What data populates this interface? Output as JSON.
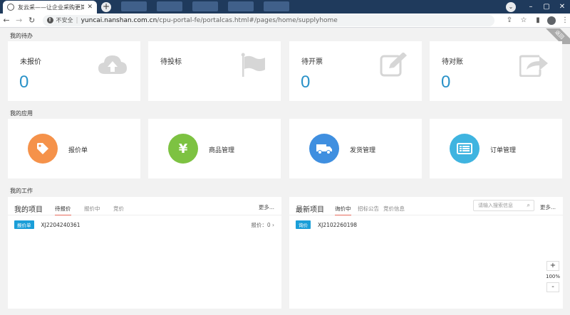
{
  "browser": {
    "tab_title": "友云采——让企业采购更简单",
    "tab_close": "✕",
    "new_tab": "+",
    "insecure_label": "不安全",
    "url_host": "yuncai.nanshan.com.cn",
    "url_path": "/cpu-portal-fe/portalcas.html#/pages/home/supplyhome"
  },
  "corner_flag": "返回",
  "todo": {
    "title": "我的待办",
    "items": [
      {
        "label": "未报价",
        "value": "0",
        "icon": "cloud-upload-icon"
      },
      {
        "label": "待投标",
        "value": "",
        "icon": "flag-icon"
      },
      {
        "label": "待开票",
        "value": "0",
        "icon": "edit-icon"
      },
      {
        "label": "待对账",
        "value": "0",
        "icon": "share-icon"
      }
    ]
  },
  "apps": {
    "title": "我的应用",
    "items": [
      {
        "label": "报价单",
        "color": "#f5924a",
        "icon": "tag-icon"
      },
      {
        "label": "商品管理",
        "color": "#7dc242",
        "icon": "yen-icon"
      },
      {
        "label": "发货管理",
        "color": "#3f8fe0",
        "icon": "truck-icon"
      },
      {
        "label": "订单管理",
        "color": "#3fb4e0",
        "icon": "order-list-icon"
      }
    ]
  },
  "work": {
    "title": "我的工作",
    "my_projects": {
      "title": "我的项目",
      "tabs": [
        "待报价",
        "报价中",
        "竞价"
      ],
      "more": "更多...",
      "rows": [
        {
          "badge": "报价单",
          "code": "XJ2204240361",
          "right": "报价：0 ›"
        }
      ]
    },
    "latest_projects": {
      "title": "最新项目",
      "tabs": [
        "询价中",
        "招标公告",
        "竞价信息"
      ],
      "search_placeholder": "请输入搜索信息",
      "more": "更多...",
      "rows": [
        {
          "badge": "询价",
          "code": "XJ2102260198"
        }
      ]
    }
  },
  "zoom": {
    "plus": "+",
    "value": "100%",
    "minus": "-"
  },
  "colors": {
    "accent": "#2a92c8",
    "badge": "#1a9ed8",
    "active_tab_underline": "#e66a5c"
  }
}
